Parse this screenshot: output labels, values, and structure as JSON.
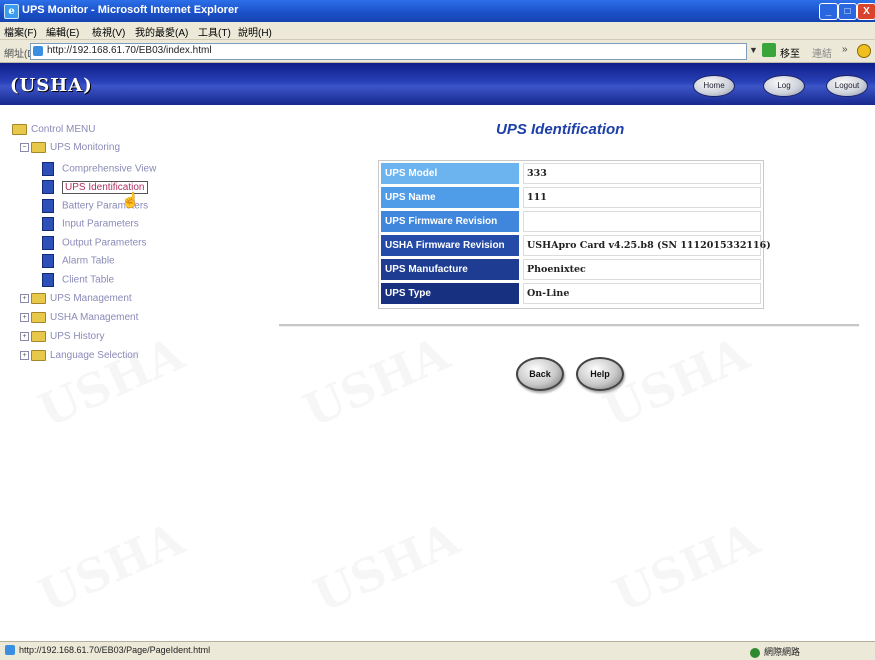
{
  "window": {
    "title": "UPS Monitor - Microsoft Internet Explorer",
    "buttons": {
      "minimize": "_",
      "maximize": "□",
      "close": "X"
    }
  },
  "browser": {
    "menu": [
      "檔案(F)",
      "編輯(E)",
      "檢視(V)",
      "我的最愛(A)",
      "工具(T)",
      "說明(H)"
    ],
    "address_label": "網址(D)",
    "url": "http://192.168.61.70/EB03/index.html",
    "go_label": "移至",
    "links_label": "連結",
    "status_url": "http://192.168.61.70/EB03/Page/PageIdent.html",
    "status_zone": "網際網路"
  },
  "header": {
    "logo": "USHA",
    "buttons": [
      "Home",
      "Log",
      "Logout"
    ]
  },
  "sidebar": {
    "root": "Control MENU",
    "groups": [
      {
        "label": "UPS Monitoring",
        "expanded": true,
        "items": [
          "Comprehensive View",
          "UPS Identification",
          "Battery Parameters",
          "Input Parameters",
          "Output Parameters",
          "Alarm Table",
          "Client Table"
        ]
      },
      {
        "label": "UPS Management",
        "expanded": false
      },
      {
        "label": "USHA Management",
        "expanded": false
      },
      {
        "label": "UPS History",
        "expanded": false
      },
      {
        "label": "Language Selection",
        "expanded": false
      }
    ],
    "selected_item": "UPS Identification"
  },
  "main": {
    "title": "UPS Identification",
    "rows": [
      {
        "label": "UPS Model",
        "value": "333"
      },
      {
        "label": "UPS Name",
        "value": "111"
      },
      {
        "label": "UPS Firmware Revision",
        "value": ""
      },
      {
        "label": "USHA Firmware Revision",
        "value": "USHApro Card v4.25.b8 (SN 1112015332116)"
      },
      {
        "label": "UPS Manufacture",
        "value": "Phoenixtec"
      },
      {
        "label": "UPS Type",
        "value": "On-Line"
      }
    ],
    "row_colors": [
      "#6bb4f0",
      "#4f9ce8",
      "#3f86dc",
      "#244ba8",
      "#1e3c92",
      "#173080"
    ],
    "back_button": "Back",
    "help_button": "Help"
  }
}
